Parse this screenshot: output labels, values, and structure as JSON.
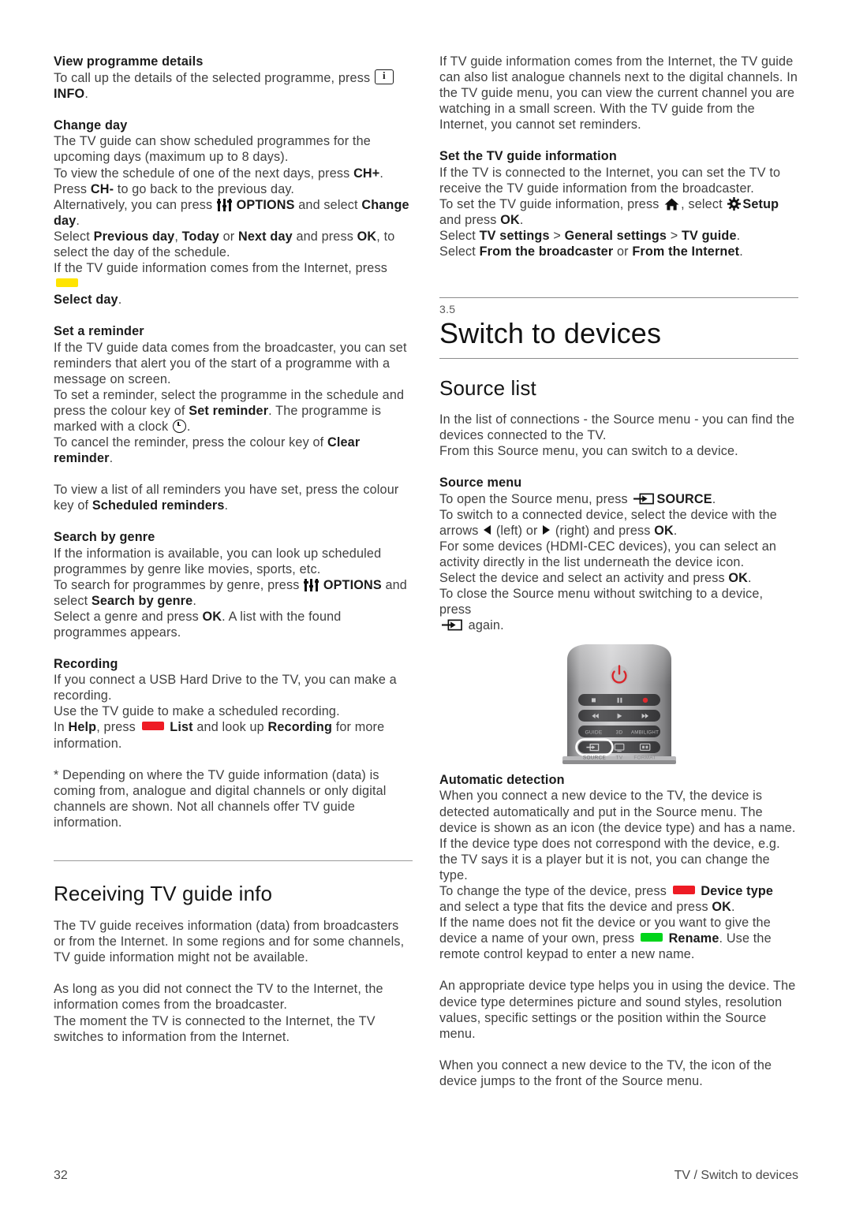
{
  "page": {
    "number": "32",
    "footer_right": "TV / Switch to devices"
  },
  "left_column": {
    "view_programme_details": {
      "heading": "View programme details",
      "line1_a": "To call up the details of the selected programme, press ",
      "line1_b": "INFO",
      "line1_c": "."
    },
    "change_day": {
      "heading": "Change day",
      "p1": "The TV guide can show scheduled programmes for the upcoming days (maximum up to 8 days).",
      "p2_a": "To view the schedule of one of the next days, press ",
      "p2_b": "CH+",
      "p2_c": ".",
      "p3_a": "Press ",
      "p3_b": "CH-",
      "p3_c": " to go back to the previous day.",
      "p4_a": "Alternatively, you can press ",
      "p4_b": "OPTIONS",
      "p4_c": " and select ",
      "p4_d": "Change day",
      "p4_e": ".",
      "p5_a": "Select ",
      "p5_b": "Previous day",
      "p5_c": ", ",
      "p5_d": "Today",
      "p5_e": " or ",
      "p5_f": "Next day",
      "p5_g": " and press ",
      "p5_h": "OK",
      "p5_i": ", to select the day of the schedule.",
      "p6_a": "If the TV guide information comes from the Internet, press ",
      "p6_b": "Select day",
      "p6_c": "."
    },
    "set_a_reminder": {
      "heading": "Set a reminder",
      "p1": "If the TV guide data comes from the broadcaster, you can set reminders that alert you of the start of a programme with a message on screen.",
      "p2_a": "To set a reminder, select the programme in the schedule and press the colour key of ",
      "p2_b": "Set reminder",
      "p2_c": ". The programme is marked with a clock ",
      "p2_d": ".",
      "p3_a": "To cancel the reminder, press the colour key of ",
      "p3_b": "Clear reminder",
      "p3_c": ".",
      "p4_a": "To view a list of all reminders you have set, press the colour key of ",
      "p4_b": "Scheduled reminders",
      "p4_c": "."
    },
    "search_by_genre": {
      "heading": "Search by genre",
      "p1": "If the information is available, you can look up scheduled programmes by genre like movies, sports, etc.",
      "p2_a": "To search for programmes by genre, press ",
      "p2_b": "OPTIONS",
      "p2_c": " and select ",
      "p2_d": "Search by genre",
      "p2_e": ".",
      "p3_a": "Select a genre and press ",
      "p3_b": "OK",
      "p3_c": ". A list with the found programmes appears."
    },
    "recording": {
      "heading": "Recording",
      "p1": "If you connect a USB Hard Drive to the TV, you can make a recording.",
      "p2": "Use the TV guide to make a scheduled recording.",
      "p3_a": "In ",
      "p3_b": "Help",
      "p3_c": ", press ",
      "p3_d": "List",
      "p3_e": " and look up ",
      "p3_f": "Recording",
      "p3_g": " for more information."
    },
    "footnote": "* Depending on where the TV guide information (data) is coming from, analogue and digital channels or only digital channels are shown. Not all channels offer TV guide information.",
    "receiving_tv_guide_info": {
      "heading": "Receiving TV guide info",
      "p1": "The TV guide receives information (data) from broadcasters or from the Internet. In some regions and for some channels, TV guide information might not be available.",
      "p2": "As long as you did not connect the TV to the Internet, the information comes from the broadcaster.",
      "p3": "The moment the TV is connected to the Internet, the TV switches to information from the Internet."
    }
  },
  "right_column": {
    "intro": "If TV guide information comes from the Internet, the TV guide can also list analogue channels next to the digital channels. In the TV guide menu, you can view the current channel you are watching in a small screen. With the TV guide from the Internet, you cannot set reminders.",
    "set_tv_guide_information": {
      "heading": "Set the TV guide information",
      "p1": "If the TV is connected to the Internet, you can set the TV to receive the TV guide information from the broadcaster.",
      "p2_a": "To set the TV guide information, press ",
      "p2_b": ", select ",
      "p2_c": "Setup",
      "p2_d": " and press ",
      "p2_e": "OK",
      "p2_f": ".",
      "p3_a": "Select ",
      "p3_b": "TV settings",
      "p3_c": " > ",
      "p3_d": "General settings",
      "p3_e": " > ",
      "p3_f": "TV guide",
      "p3_g": ".",
      "p4_a": "Select ",
      "p4_b": "From the broadcaster",
      "p4_c": " or ",
      "p4_d": "From the Internet",
      "p4_e": "."
    },
    "chapter": {
      "number": "3.5",
      "title": "Switch to devices"
    },
    "source_list": {
      "heading": "Source list",
      "p1": "In the list of connections - the Source menu - you can find the devices connected to the TV.",
      "p2": "From this Source menu, you can switch to a device."
    },
    "source_menu": {
      "heading": "Source menu",
      "p1_a": "To open the Source menu, press ",
      "p1_b": "SOURCE",
      "p1_c": ".",
      "p2_a": "To switch to a connected device, select the device with the arrows ",
      "p2_b": " (left) or ",
      "p2_c": " (right) and press ",
      "p2_d": "OK",
      "p2_e": ".",
      "p3": "For some devices (HDMI-CEC devices), you can select an activity directly in the list underneath the device icon.",
      "p4_a": "Select the device and select an activity and press ",
      "p4_b": "OK",
      "p4_c": ".",
      "p5_a": "To close the Source menu without switching to a device, press ",
      "p5_b": " again."
    },
    "remote": {
      "alt": "Philips remote control top section",
      "buttons": [
        "stop",
        "pause",
        "record",
        "rewind",
        "play",
        "forward",
        "GUIDE",
        "3D",
        "AMBILIGHT",
        "SOURCE",
        "TV",
        "FORMAT"
      ],
      "labels": {
        "guide": "GUIDE",
        "three_d": "3D",
        "ambilight": "AMBILIGHT",
        "source": "SOURCE",
        "tv": "TV",
        "format": "FORMAT"
      }
    },
    "automatic_detection": {
      "heading": "Automatic detection",
      "p1": "When you connect a new device to the TV, the device is detected automatically and put in the Source menu. The device is shown as an icon (the device type) and has a name. If the device type does not correspond with the device, e.g. the TV says it is a player but it is not, you can change the type.",
      "p2_a": "To change the type of the device, press ",
      "p2_b": "Device type",
      "p2_c": " and select a type that fits the device and press ",
      "p2_d": "OK",
      "p2_e": ".",
      "p3_a": "If the name does not fit the device or you want to give the device a name of your own, press ",
      "p3_b": "Rename",
      "p3_c": ". Use the remote control keypad to enter a new name.",
      "p4": "An appropriate device type helps you in using the device. The device type determines picture and sound styles, resolution values, specific settings or the position within the Source menu.",
      "p5": "When you connect a new device to the TV, the icon of the device jumps to the front of the Source menu."
    }
  },
  "colors": {
    "yellow_key": "#ffe400",
    "red_key": "#ee1b24",
    "green_key": "#00d41a",
    "body_text": "#3f3f3f",
    "bold_text": "#1b1b1b",
    "rule": "#8c8c8c"
  }
}
